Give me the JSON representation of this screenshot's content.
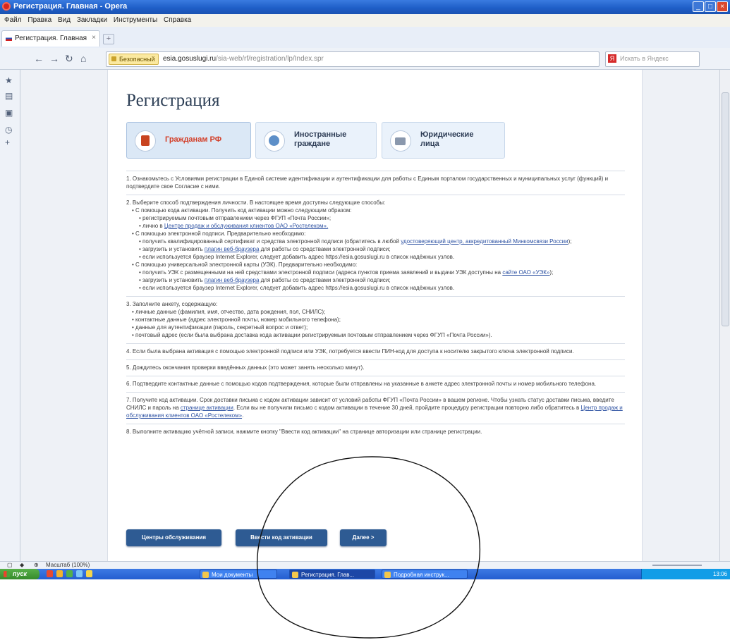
{
  "window": {
    "title": "Регистрация. Главная - Opera"
  },
  "menu": [
    "Файл",
    "Правка",
    "Вид",
    "Закладки",
    "Инструменты",
    "Справка"
  ],
  "tab": {
    "label": "Регистрация. Главная"
  },
  "nav": {
    "secure_label": "Безопасный",
    "url_domain": "esia.gosuslugi.ru",
    "url_path": "/sia-web/rf/registration/lp/Index.spr",
    "search_placeholder": "Искать в Яндекс"
  },
  "page": {
    "title": "Регистрация",
    "tabs": [
      {
        "label": "Гражданам РФ",
        "active": true
      },
      {
        "label": "Иностранные граждане",
        "active": false
      },
      {
        "label": "Юридические лица",
        "active": false
      }
    ],
    "steps": {
      "s1": "1. Ознакомьтесь с Условиями регистрации в Единой системе идентификации и аутентификации для работы с Единым порталом государственных и муниципальных услуг (функций) и подтвердите свое Согласие с ними.",
      "s2": "2. Выберите способ подтверждения личности. В настоящее время доступны следующие способы:",
      "s2a": "• С помощью кода активации. Получить код активации можно следующим образом:",
      "s2a1": "• регистрируемым почтовым отправлением через ФГУП «Почта России»;",
      "s2a2_pre": "• лично в ",
      "s2a2_link": "Центре продаж и обслуживания клиентов ОАО «Ростелеком».",
      "s2b": "• С помощью электронной подписи. Предварительно необходимо:",
      "s2b1_pre": "• получить квалифицированный сертификат и средства электронной подписи (обратитесь в любой ",
      "s2b1_link": "удостоверяющий центр, аккредитованный Минкомсвязи России",
      "s2b1_post": ");",
      "s2b2_pre": "• загрузить и установить ",
      "s2b2_link": "плагин веб-браузера",
      "s2b2_post": " для работы со средствами электронной подписи;",
      "s2b3": "• если используется браузер Internet Explorer, следует добавить адрес https://esia.gosuslugi.ru в список надёжных узлов.",
      "s2c": "• С помощью универсальной электронной карты (УЭК). Предварительно необходимо:",
      "s2c1_pre": "• получить УЭК с размещенными на ней средствами электронной подписи (адреса пунктов приема заявлений и выдачи УЭК доступны на ",
      "s2c1_link": "сайте ОАО «УЭК»",
      "s2c1_post": ");",
      "s2c2_pre": "• загрузить и установить ",
      "s2c2_link": "плагин веб-браузера",
      "s2c2_post": " для работы со средствами электронной подписи;",
      "s2c3": "• если используется браузер Internet Explorer, следует добавить адрес https://esia.gosuslugi.ru в список надёжных узлов.",
      "s3": "3. Заполните анкету, содержащую:",
      "s3a": "• личные данные (фамилия, имя, отчество, дата рождения, пол, СНИЛС);",
      "s3b": "• контактные данные (адрес электронной почты, номер мобильного телефона);",
      "s3c": "• данные для аутентификации (пароль, секретный вопрос и ответ);",
      "s3d": "• почтовый адрес (если была выбрана доставка кода активации регистрируемым почтовым отправлением через ФГУП «Почта России»).",
      "s4": "4. Если была выбрана активация с помощью электронной подписи или УЭК, потребуется ввести ПИН-код для доступа к носителю закрытого ключа электронной подписи.",
      "s5": "5. Дождитесь окончания проверки введённых данных (это может занять несколько минут).",
      "s6": "6. Подтвердите контактные данные с помощью кодов подтверждения, которые были отправлены на указанные в анкете адрес электронной почты и номер мобильного телефона.",
      "s7_pre": "7. Получите код активации. Срок доставки письма с кодом активации зависит от условий работы ФГУП «Почта России» в вашем регионе. Чтобы узнать статус доставки письма, введите СНИЛС и пароль на ",
      "s7_link1": "странице активации",
      "s7_mid": ". Если вы не получили письмо с кодом активации в течение 30 дней, пройдите процедуру регистрации повторно либо обратитесь в ",
      "s7_link2": "Центр продаж и обслуживания клиентов ОАО «Ростелеком»",
      "s7_post": ".",
      "s8": "8. Выполните активацию учётной записи, нажмите кнопку \"Ввести код активации\" на странице авторизации или странице регистрации."
    },
    "buttons": {
      "centers": "Центры обслуживания",
      "activation": "Ввести код активации",
      "next": "Далее >"
    }
  },
  "status": {
    "zoom": "Масштаб (100%)"
  },
  "taskbar": {
    "start": "пуск",
    "items": [
      "Мои документы",
      "Регистрация. Глав...",
      "Подробная инструк..."
    ],
    "clock": "13:06"
  }
}
